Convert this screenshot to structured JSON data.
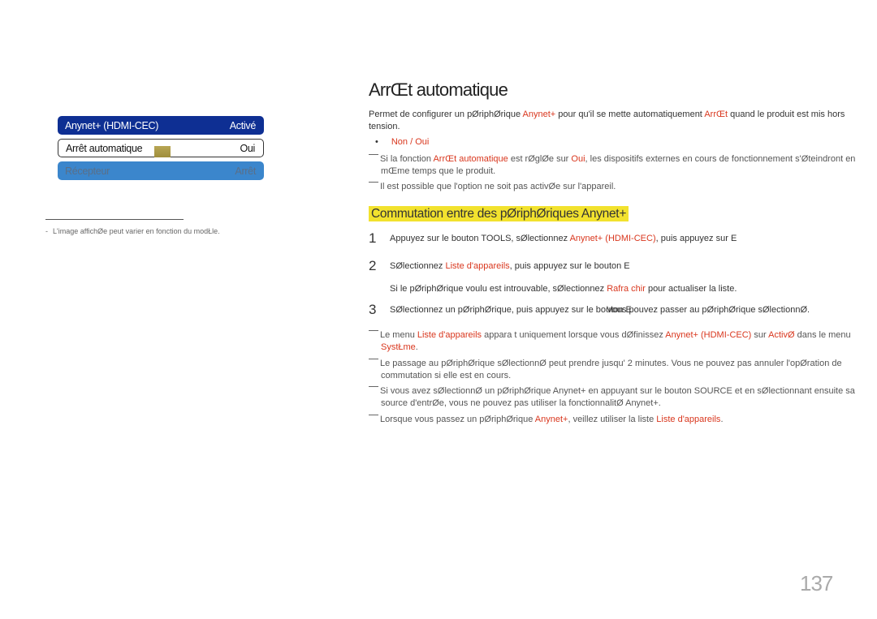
{
  "osd_menu": {
    "rows": [
      {
        "label": "Anynet+ (HDMI-CEC)",
        "value": "Activé",
        "state": "highlighted"
      },
      {
        "label": "Arrêt automatique",
        "value": "Oui",
        "state": "selected"
      },
      {
        "label": "Récepteur",
        "value": "Arrêt",
        "state": "disabled"
      }
    ],
    "colors": {
      "highlight": "#0e2f93",
      "disabled": "#3b86cc",
      "cursor": "#b8a654"
    }
  },
  "footnote": {
    "dash": "-",
    "text": "L'image affichØe peut varier en fonction du modŁle."
  },
  "main": {
    "title": "ArrŒt automatique",
    "intro": {
      "p1": "Permet de configurer un pØriphØrique ",
      "link1": "Anynet+",
      "p2": " pour qu'il se mette automatiquement ",
      "link2": "ArrŒt",
      "p3": " quand le produit est mis hors",
      "p4": "tension."
    },
    "options": {
      "bullet": "•",
      "text": "Non / Oui"
    },
    "notes": [
      {
        "a": "Si la fonction ",
        "b": "ArrŒt automatique",
        "c": " est rØglØe sur ",
        "d": "Oui",
        "e": ", les dispositifs externes en cours de fonctionnement s'Øteindront en",
        "f": "mŒme temps que le produit."
      },
      {
        "a": "Il est possible que l'option ne soit pas activØe sur l'appareil."
      }
    ],
    "section": {
      "heading": "Commutation entre des pØriphØriques Anynet+",
      "steps": [
        {
          "num": "1",
          "a": "Appuyez sur le bouton TOOLS, sØlectionnez ",
          "b": "Anynet+ (HDMI-CEC)",
          "c": ", puis appuyez sur E"
        },
        {
          "num": "2",
          "a": "SØlectionnez ",
          "b": "Liste d'appareils",
          "c": ", puis appuyez sur le bouton E",
          "sub_a": "Si le pØriphØrique voulu est introuvable, sØlectionnez ",
          "sub_b": "Rafra chir",
          "sub_c": " pour actualiser la liste."
        },
        {
          "num": "3",
          "a": "SØlectionnez un pØriphØrique, puis appuyez sur le bouton E",
          "c": "Vous pouvez passer au pØriphØrique sØlectionnØ."
        }
      ],
      "notes": [
        {
          "a": "Le menu ",
          "b": "Liste d'appareils",
          "c": " appara t uniquement lorsque vous dØfinissez ",
          "d": "Anynet+ (HDMI-CEC)",
          "e": " sur ",
          "f": "ActivØ",
          "g": " dans le menu",
          "h": "SystŁme",
          "i": "."
        },
        {
          "a": "Le passage au pØriphØrique sØlectionnØ peut prendre jusqu'  2 minutes. Vous ne pouvez pas annuler l'opØration de",
          "b": "commutation si elle est en cours."
        },
        {
          "a": "Si vous avez sØlectionnØ un pØriphØrique Anynet+ en appuyant sur le bouton SOURCE et en sØlectionnant ensuite sa",
          "b": "source d'entrØe, vous ne pouvez pas utiliser la fonctionnalitØ Anynet+."
        },
        {
          "a": "Lorsque vous passez   un pØriphØrique ",
          "b": "Anynet+",
          "c": ", veillez   utiliser la liste ",
          "d": "Liste d'appareils",
          "e": "."
        }
      ]
    }
  },
  "page_number": "137"
}
